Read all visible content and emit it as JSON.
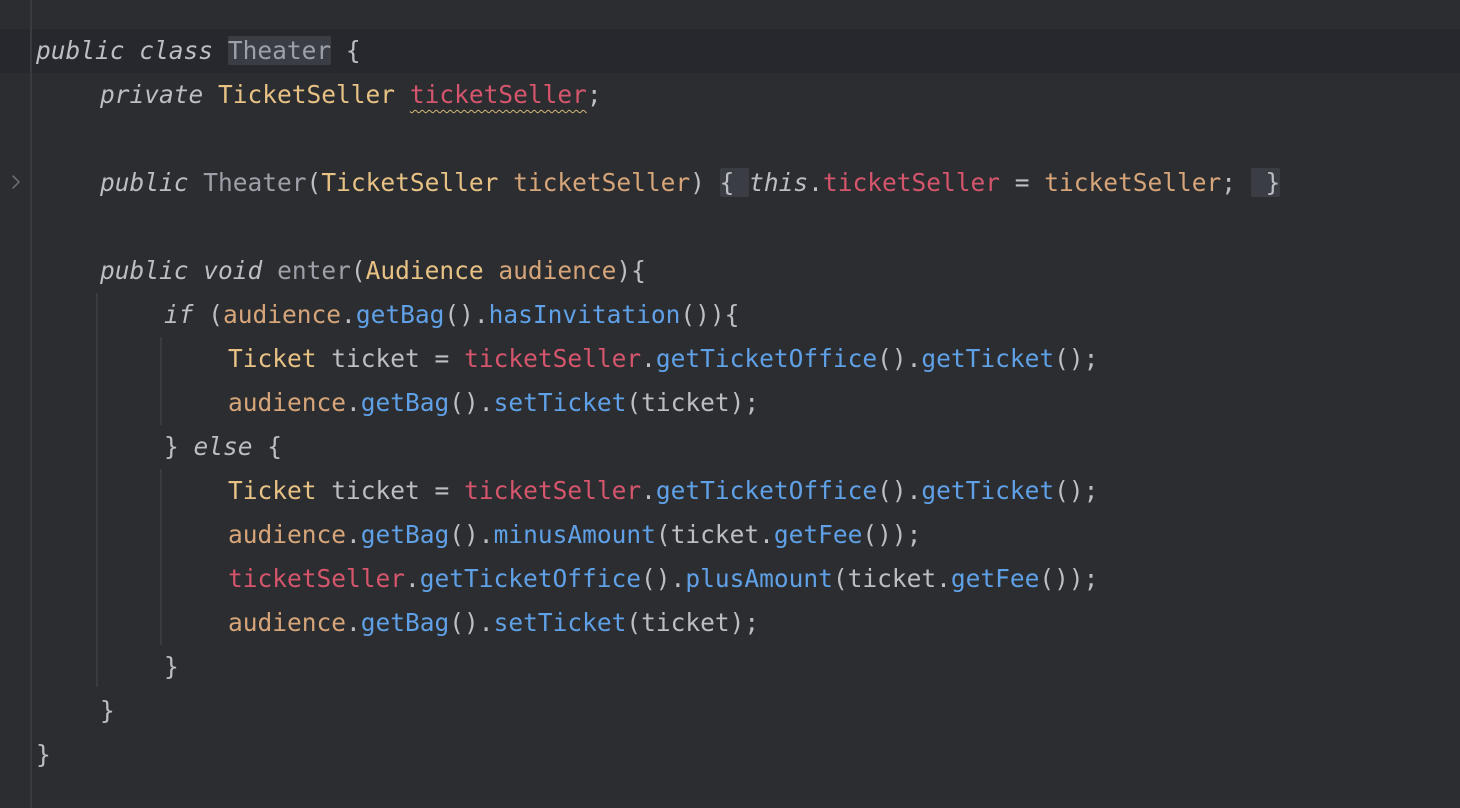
{
  "editor": {
    "colors": {
      "background": "#2b2d30",
      "keyword": "#bcbec4",
      "type": "#e8c285",
      "field": "#d5566c",
      "parameter": "#d7a57a",
      "method": "#5fa0e6",
      "identifier": "#9da0a8",
      "text": "#bcbec4"
    },
    "fold_icon": "chevron-right-icon",
    "tokens": {
      "public": "public",
      "class": "class",
      "private": "private",
      "void": "void",
      "if": "if",
      "else": "else",
      "this": "this",
      "class_name": "Theater",
      "type_ticket_seller": "TicketSeller",
      "type_audience": "Audience",
      "type_ticket": "Ticket",
      "field_ticket_seller": "ticketSeller",
      "param_ticket_seller": "ticketSeller",
      "param_audience": "audience",
      "var_ticket": "ticket",
      "method_enter": "enter",
      "get_bag": "getBag",
      "has_invitation": "hasInvitation",
      "get_ticket_office": "getTicketOffice",
      "get_ticket": "getTicket",
      "set_ticket": "setTicket",
      "minus_amount": "minusAmount",
      "plus_amount": "plusAmount",
      "get_fee": "getFee"
    }
  }
}
